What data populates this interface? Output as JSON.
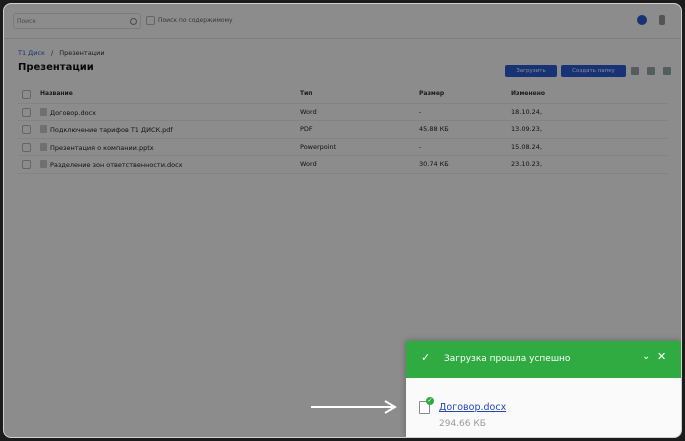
{
  "search": {
    "placeholder": "Поиск",
    "content_search_label": "Поиск по содержимому"
  },
  "breadcrumb": {
    "root": "Т1 Диск",
    "separator": "/",
    "current": "Презентации"
  },
  "page": {
    "title": "Презентации"
  },
  "toolbar": {
    "upload_label": "Загрузить",
    "create_folder_label": "Создать папку"
  },
  "table": {
    "headers": {
      "name": "Название",
      "type": "Тип",
      "size": "Размер",
      "modified": "Изменено"
    },
    "rows": [
      {
        "name": "Договор.docx",
        "type": "Word",
        "size": "-",
        "modified": "18.10.24,"
      },
      {
        "name": "Подключение тарифов Т1 ДИСК.pdf",
        "type": "PDF",
        "size": "45.88 КБ",
        "modified": "13.09.23,"
      },
      {
        "name": "Презентация о компании.pptx",
        "type": "Powerpoint",
        "size": "-",
        "modified": "15.08.24,"
      },
      {
        "name": "Разделение зон ответственности.docx",
        "type": "Word",
        "size": "30.74 КБ",
        "modified": "23.10.23,"
      }
    ]
  },
  "toast": {
    "title": "Загрузка прошла успешно",
    "file_name": "Договор.docx",
    "file_size": "294.66 КБ"
  },
  "colors": {
    "accent": "#2d5bd7",
    "success": "#2fab42",
    "link": "#2447b5"
  }
}
